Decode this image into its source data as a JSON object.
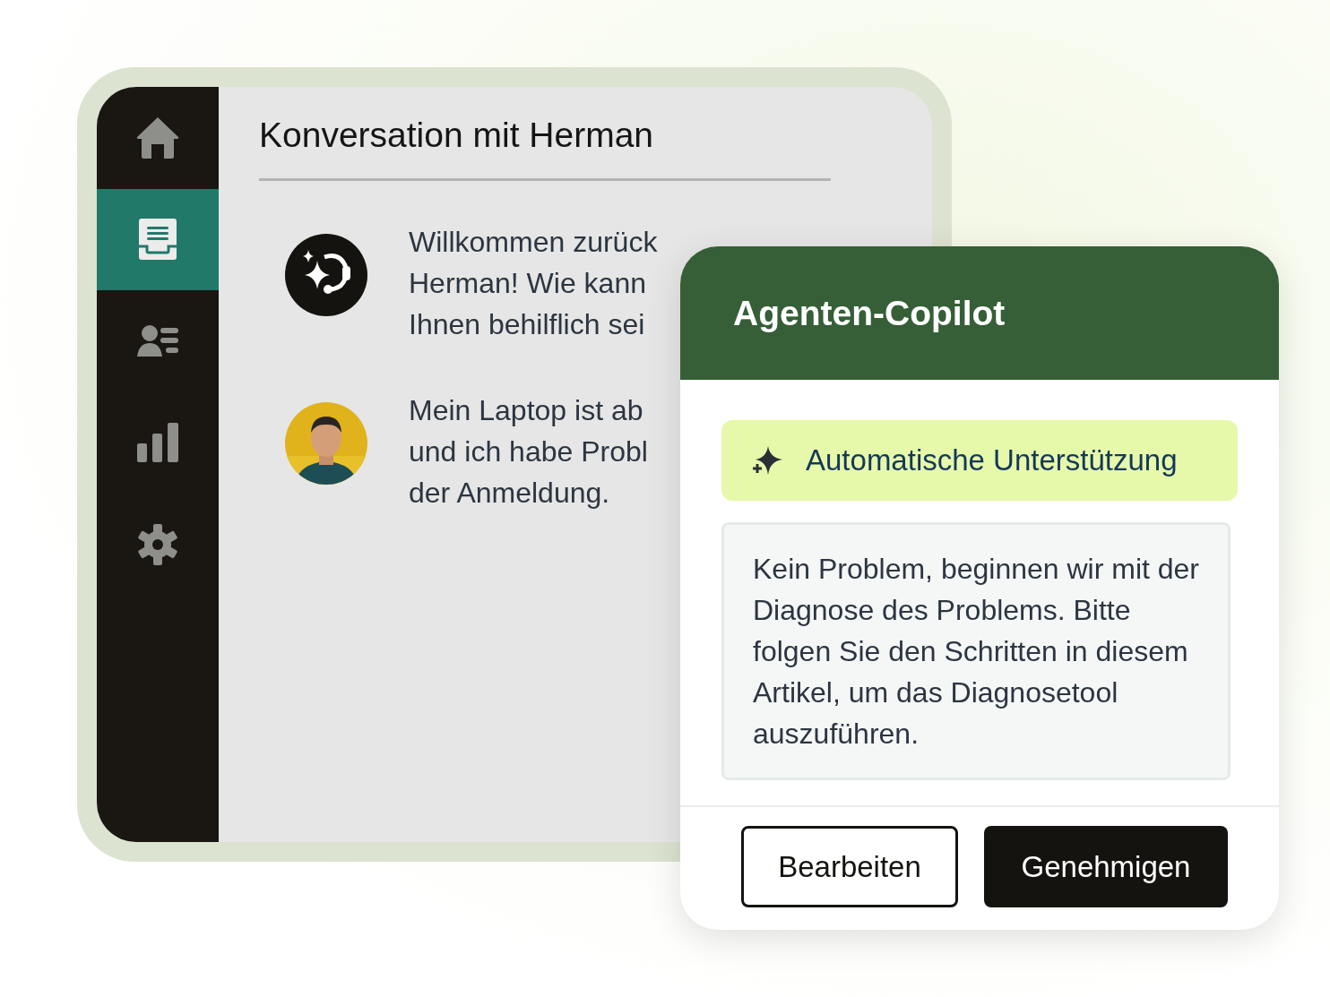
{
  "sidebar": {
    "items": [
      {
        "selected": false
      },
      {
        "selected": true
      },
      {
        "selected": false
      },
      {
        "selected": false
      },
      {
        "selected": false
      }
    ]
  },
  "conversation": {
    "title": "Konversation mit Herman",
    "messages": [
      {
        "kind": "bot",
        "lines": [
          "Willkommen zurück",
          "Herman! Wie kann",
          "Ihnen behilflich sei"
        ]
      },
      {
        "kind": "user",
        "lines": [
          "Mein Laptop ist ab",
          "und ich habe Probl",
          "der Anmeldung."
        ]
      }
    ]
  },
  "copilot": {
    "title": "Agenten-Copilot",
    "badge": "Automatische Unterstützung",
    "suggestion": "Kein Problem, beginnen wir mit der Diagnose des Problems. Bitte folgen Sie den Schritten in diesem Artikel, um das Diagnosetool auszuführen.",
    "buttons": [
      {
        "label": "Bearbeiten",
        "kind": "secondary"
      },
      {
        "label": "Genehmigen",
        "kind": "primary"
      }
    ]
  }
}
